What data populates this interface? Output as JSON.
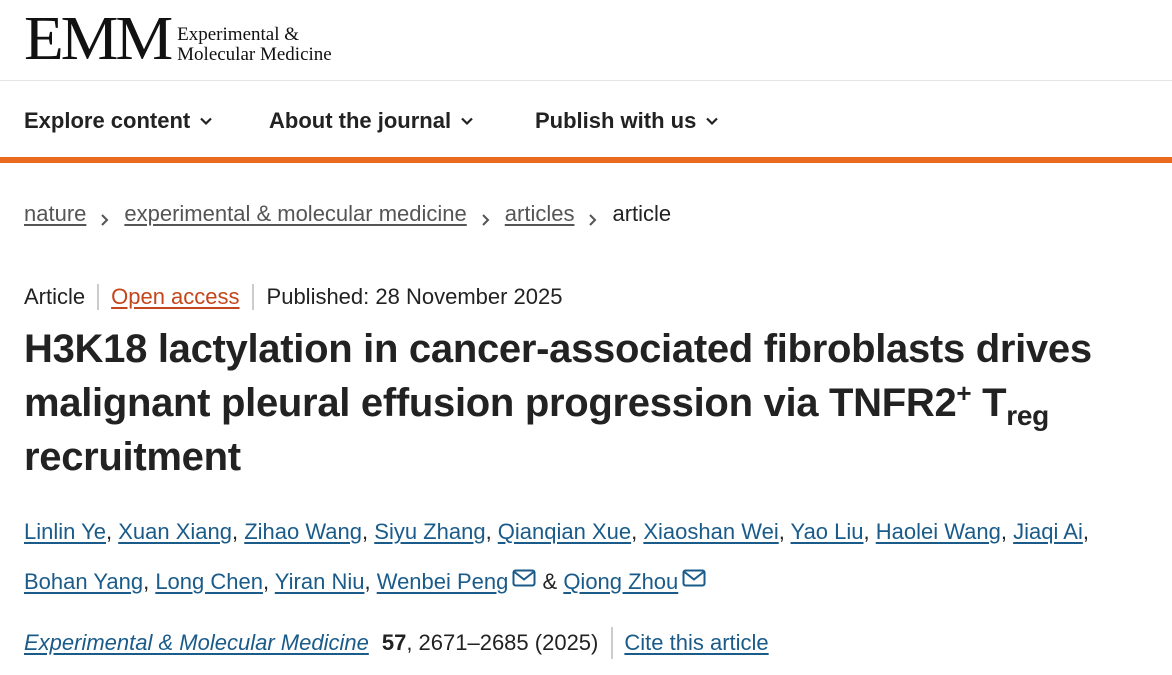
{
  "header": {
    "logo_mark": "EMM",
    "logo_line1": "Experimental &",
    "logo_line2": "Molecular Medicine"
  },
  "nav": {
    "items": [
      {
        "label": "Explore content"
      },
      {
        "label": "About the journal"
      },
      {
        "label": "Publish with us"
      }
    ]
  },
  "breadcrumb": {
    "items": [
      "nature",
      "experimental & molecular medicine",
      "articles"
    ],
    "current": "article"
  },
  "meta": {
    "type": "Article",
    "access": "Open access",
    "published": "Published: 28 November 2025"
  },
  "title": {
    "line_part1": "H3K18 lactylation in cancer-associated fibroblasts drives malignant pleural effusion progression via TNFR2",
    "sup": "+",
    "part2": " T",
    "sub": "reg",
    "part3": " recruitment"
  },
  "authors": [
    "Linlin Ye",
    "Xuan Xiang",
    "Zihao Wang",
    "Siyu Zhang",
    "Qianqian Xue",
    "Xiaoshan Wei",
    "Yao Liu",
    "Haolei Wang",
    "Jiaqi Ai",
    "Bohan Yang",
    "Long Chen",
    "Yiran Niu",
    "Wenbei Peng",
    "Qiong Zhou"
  ],
  "authors_sep": ", ",
  "authors_and": " & ",
  "citation": {
    "journal": "Experimental & Molecular Medicine",
    "volume": "57",
    "pages_year": ", 2671–2685 (2025)",
    "cite_label": "Cite this article"
  },
  "colors": {
    "accent_orange": "#e9691e",
    "link_blue": "#1a5b8a",
    "open_access": "#c4461b"
  }
}
